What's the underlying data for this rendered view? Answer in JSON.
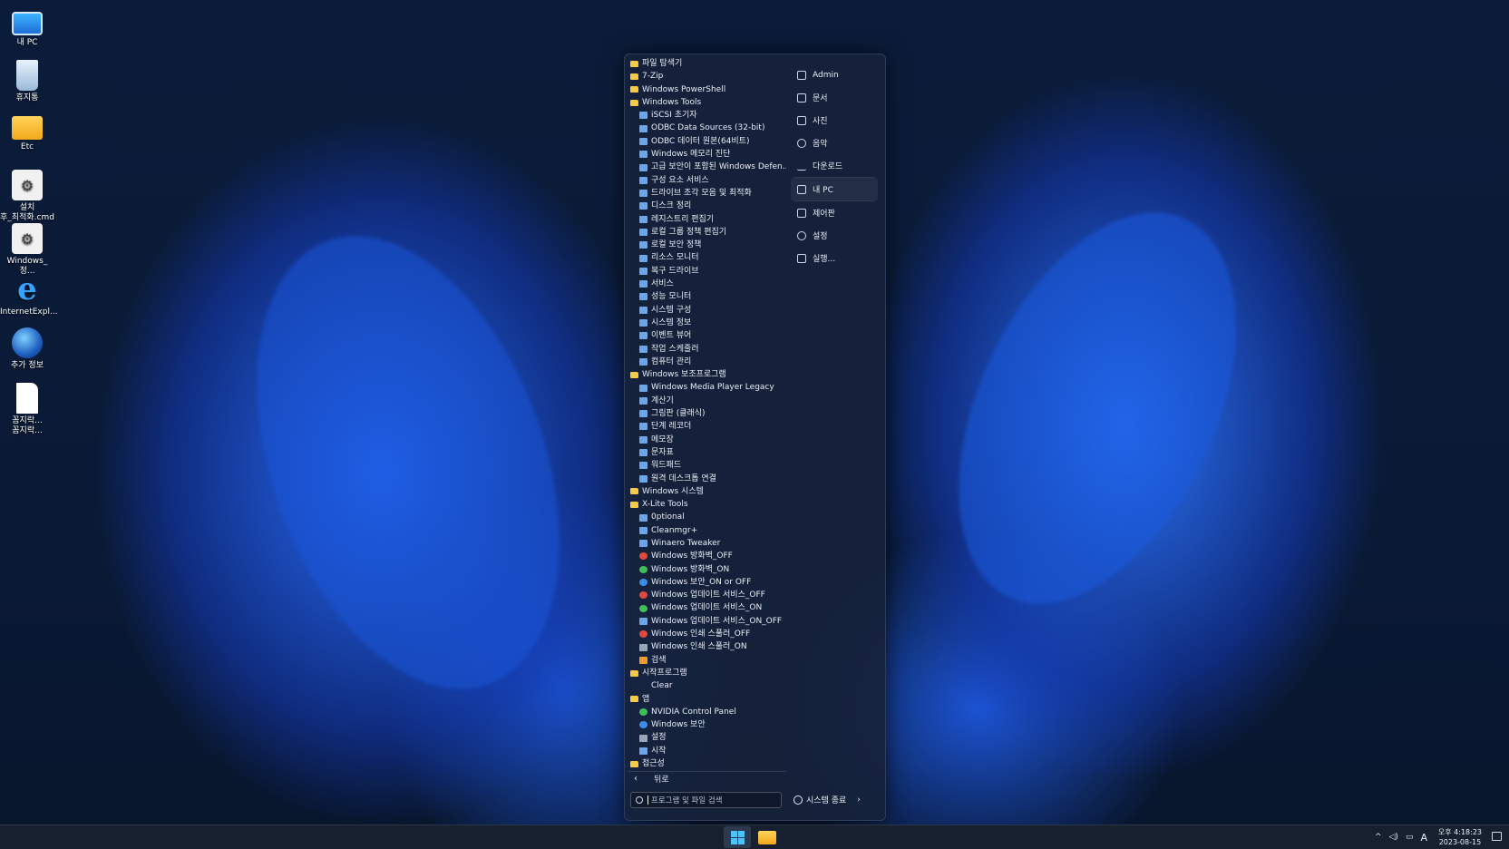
{
  "desktop": {
    "icons": [
      {
        "label": "내 PC",
        "icon": "monitor-icon"
      },
      {
        "label": "휴지통",
        "icon": "recycle-bin-icon"
      },
      {
        "label": "Etc",
        "icon": "folder-icon"
      },
      {
        "label": "설치\n후_최적화.cmd",
        "icon": "cmd-gear-icon"
      },
      {
        "label": "Windows_정...",
        "icon": "cmd-gear-icon"
      },
      {
        "label": "InternetExpl...",
        "icon": "internet-explorer-icon"
      },
      {
        "label": "추가 정보",
        "icon": "globe-icon"
      },
      {
        "label": "꼼지락...\n꼼지락...",
        "icon": "file-icon"
      }
    ]
  },
  "start_menu": {
    "items": [
      {
        "label": "파일 탐색기",
        "level": 0,
        "icon": "folder-open-icon"
      },
      {
        "label": "7-Zip",
        "level": 0,
        "icon": "folder-icon"
      },
      {
        "label": "Windows PowerShell",
        "level": 0,
        "icon": "folder-icon"
      },
      {
        "label": "Windows Tools",
        "level": 0,
        "icon": "folder-icon"
      },
      {
        "label": "iSCSI 초기자",
        "level": 1,
        "icon": "app-icon"
      },
      {
        "label": "ODBC Data Sources (32-bit)",
        "level": 1,
        "icon": "app-icon"
      },
      {
        "label": "ODBC 데이터 원본(64비트)",
        "level": 1,
        "icon": "app-icon"
      },
      {
        "label": "Windows 메모리 진단",
        "level": 1,
        "icon": "app-icon"
      },
      {
        "label": "고급 보안이 포함된 Windows Defen...",
        "level": 1,
        "icon": "app-icon"
      },
      {
        "label": "구성 요소 서비스",
        "level": 1,
        "icon": "app-icon"
      },
      {
        "label": "드라이브 조각 모음 및 최적화",
        "level": 1,
        "icon": "app-icon"
      },
      {
        "label": "디스크 정리",
        "level": 1,
        "icon": "app-icon"
      },
      {
        "label": "레지스트리 편집기",
        "level": 1,
        "icon": "app-icon"
      },
      {
        "label": "로컬 그룹 정책 편집기",
        "level": 1,
        "icon": "app-icon"
      },
      {
        "label": "로컬 보안 정책",
        "level": 1,
        "icon": "app-icon"
      },
      {
        "label": "리소스 모니터",
        "level": 1,
        "icon": "app-icon"
      },
      {
        "label": "복구 드라이브",
        "level": 1,
        "icon": "app-icon"
      },
      {
        "label": "서비스",
        "level": 1,
        "icon": "app-icon"
      },
      {
        "label": "성능 모니터",
        "level": 1,
        "icon": "app-icon"
      },
      {
        "label": "시스템 구성",
        "level": 1,
        "icon": "app-icon"
      },
      {
        "label": "시스템 정보",
        "level": 1,
        "icon": "app-icon"
      },
      {
        "label": "이벤트 뷰어",
        "level": 1,
        "icon": "app-icon"
      },
      {
        "label": "작업 스케줄러",
        "level": 1,
        "icon": "app-icon"
      },
      {
        "label": "컴퓨터 관리",
        "level": 1,
        "icon": "app-icon"
      },
      {
        "label": "Windows 보조프로그램",
        "level": 0,
        "icon": "folder-icon"
      },
      {
        "label": "Windows Media Player Legacy",
        "level": 1,
        "icon": "app-icon"
      },
      {
        "label": "계산기",
        "level": 1,
        "icon": "app-icon"
      },
      {
        "label": "그림판 (클래식)",
        "level": 1,
        "icon": "app-icon"
      },
      {
        "label": "단계 레코더",
        "level": 1,
        "icon": "app-icon"
      },
      {
        "label": "메모장",
        "level": 1,
        "icon": "app-icon"
      },
      {
        "label": "문자표",
        "level": 1,
        "icon": "app-icon"
      },
      {
        "label": "워드패드",
        "level": 1,
        "icon": "app-icon"
      },
      {
        "label": "원격 데스크톱 연결",
        "level": 1,
        "icon": "app-icon"
      },
      {
        "label": "Windows 시스템",
        "level": 0,
        "icon": "folder-icon"
      },
      {
        "label": "X-Lite Tools",
        "level": 0,
        "icon": "folder-icon"
      },
      {
        "label": "0ptional",
        "level": 1,
        "icon": "app-icon"
      },
      {
        "label": "Cleanmgr+",
        "level": 1,
        "icon": "app-icon"
      },
      {
        "label": "Winaero Tweaker",
        "level": 1,
        "icon": "app-icon"
      },
      {
        "label": "Windows 방화벽_OFF",
        "level": 1,
        "icon": "shield-red-icon"
      },
      {
        "label": "Windows 방화벽_ON",
        "level": 1,
        "icon": "shield-green-icon"
      },
      {
        "label": "Windows 보안_ON or OFF",
        "level": 1,
        "icon": "shield-blue-icon"
      },
      {
        "label": "Windows 업데이트 서비스_OFF",
        "level": 1,
        "icon": "red-x-icon"
      },
      {
        "label": "Windows 업데이트 서비스_ON",
        "level": 1,
        "icon": "green-check-icon"
      },
      {
        "label": "Windows 업데이트 서비스_ON_OFF",
        "level": 1,
        "icon": "app-icon"
      },
      {
        "label": "Windows 인쇄 스풀러_OFF",
        "level": 1,
        "icon": "red-x-icon"
      },
      {
        "label": "Windows 인쇄 스풀러_ON",
        "level": 1,
        "icon": "printer-icon"
      },
      {
        "label": "검색",
        "level": 1,
        "icon": "search-icon"
      },
      {
        "label": "시작프로그램",
        "level": 0,
        "icon": "folder-icon"
      },
      {
        "label": "Clear",
        "level": 1,
        "icon": "blank-icon"
      },
      {
        "label": "앱",
        "level": 0,
        "icon": "folder-icon"
      },
      {
        "label": "NVIDIA Control Panel",
        "level": 1,
        "icon": "nvidia-icon"
      },
      {
        "label": "Windows 보안",
        "level": 1,
        "icon": "shield-blue-icon"
      },
      {
        "label": "설정",
        "level": 1,
        "icon": "gear-icon"
      },
      {
        "label": "시작",
        "level": 1,
        "icon": "app-icon"
      },
      {
        "label": "접근성",
        "level": 0,
        "icon": "folder-icon"
      }
    ],
    "back_label": "뒤로",
    "search_placeholder": "프로그램 및 파일 검색",
    "right_pane": [
      {
        "label": "Admin",
        "icon": "user-icon"
      },
      {
        "label": "문서",
        "icon": "document-icon"
      },
      {
        "label": "사진",
        "icon": "picture-icon"
      },
      {
        "label": "음악",
        "icon": "music-icon"
      },
      {
        "label": "다운로드",
        "icon": "download-icon"
      },
      {
        "label": "내 PC",
        "icon": "computer-icon"
      },
      {
        "label": "제어판",
        "icon": "control-panel-icon"
      },
      {
        "label": "설정",
        "icon": "gear-icon"
      },
      {
        "label": "실행...",
        "icon": "run-icon"
      }
    ],
    "shutdown_label": "시스템 종료"
  },
  "taskbar": {
    "tray_ime": "A",
    "time": "오후 4:18:23",
    "date": "2023-08-15"
  }
}
